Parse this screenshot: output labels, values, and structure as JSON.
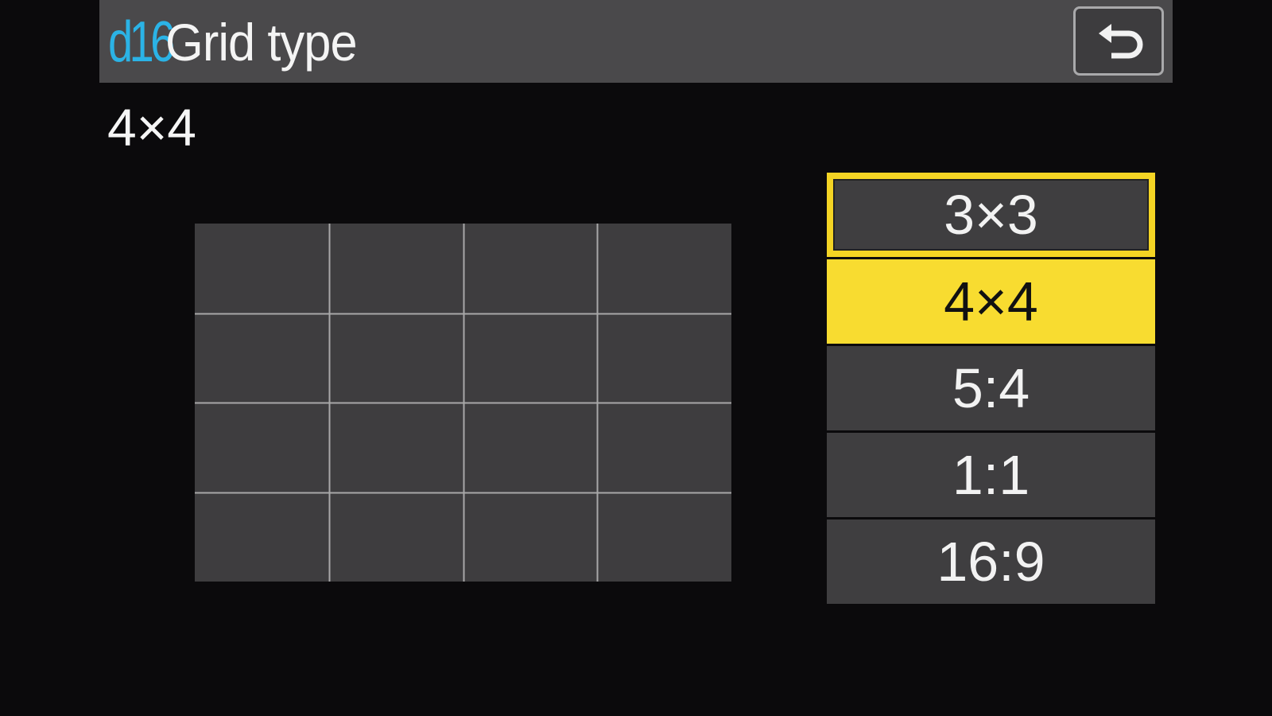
{
  "header": {
    "menu_code": "d16",
    "title": "Grid type",
    "back_icon": "back-arrow-icon"
  },
  "current_value": "4×4",
  "preview": {
    "rows": 4,
    "columns": 4
  },
  "options": [
    {
      "label": "3×3",
      "state": "focused"
    },
    {
      "label": "4×4",
      "state": "selected"
    },
    {
      "label": "5:4",
      "state": "normal"
    },
    {
      "label": "1:1",
      "state": "normal"
    },
    {
      "label": "16:9",
      "state": "normal"
    }
  ],
  "colors": {
    "accent_yellow": "#f8dc30",
    "menu_code_blue": "#2bb3e6",
    "panel_gray": "#3f3e40",
    "header_gray": "#4a494b",
    "background": "#0b0a0c"
  }
}
